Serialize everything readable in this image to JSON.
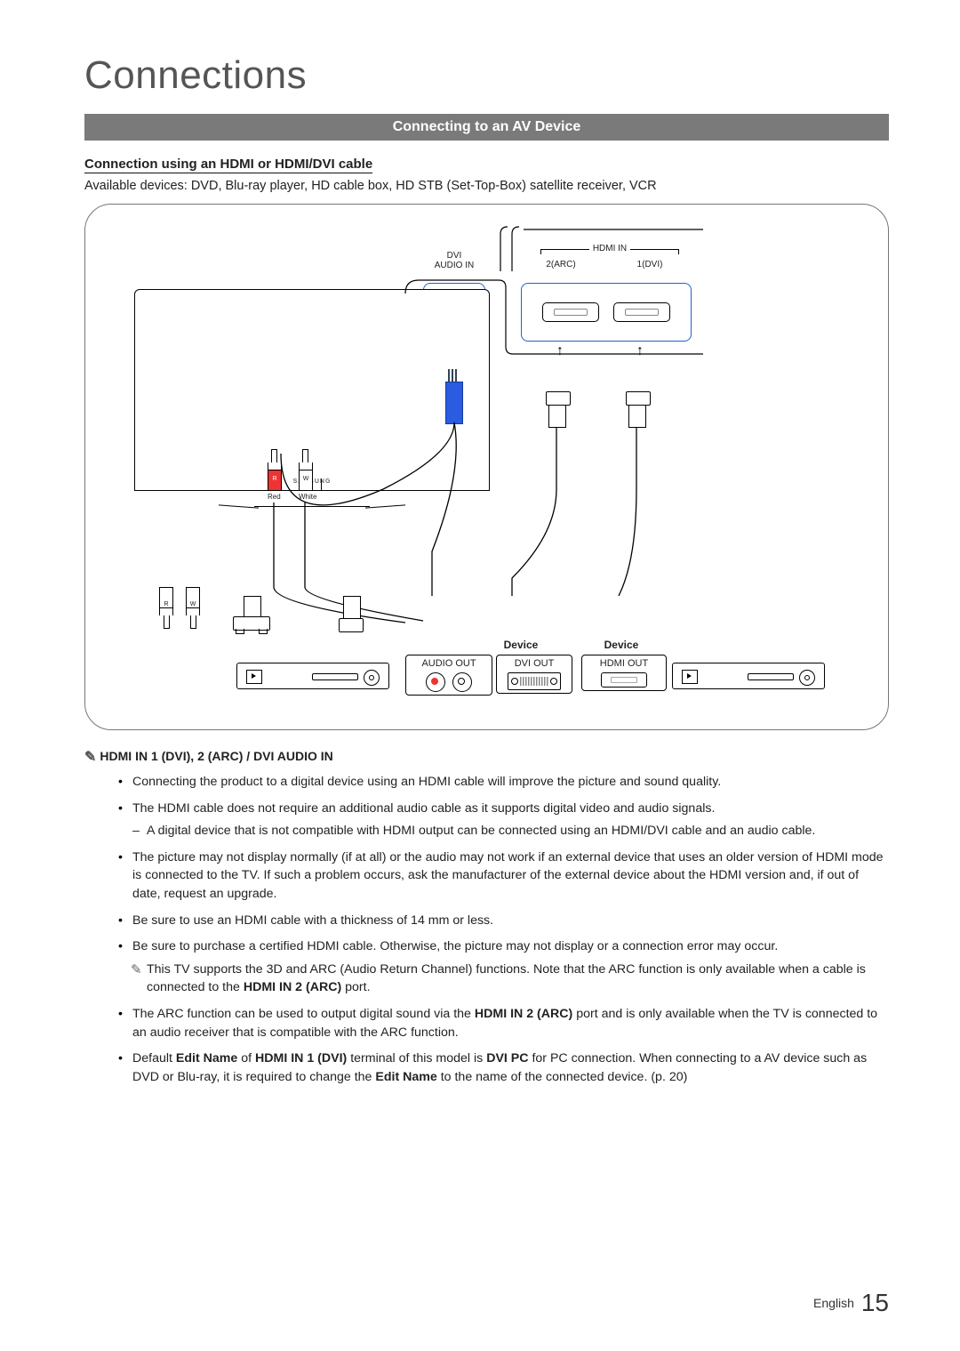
{
  "page": {
    "section_title": "Connections",
    "banner": "Connecting to an AV Device",
    "subhead": "Connection using an HDMI or HDMI/DVI cable",
    "available": "Available devices: DVD, Blu-ray player, HD cable box, HD STB (Set-Top-Box) satellite receiver, VCR"
  },
  "diagram": {
    "tv_brand": "SAMSUNG",
    "dvi_audio_label_1": "DVI",
    "dvi_audio_label_2": "AUDIO IN",
    "hdmi_in_label": "HDMI IN",
    "hdmi_in_2": "2(ARC)",
    "hdmi_in_1": "1(DVI)",
    "rca_red": "Red",
    "rca_white": "White",
    "rca_r": "R",
    "rca_w": "W",
    "rca_r2": "R",
    "rca_w2": "W",
    "device_label_left": "Device",
    "device_label_right": "Device",
    "audio_out": "AUDIO OUT",
    "dvi_out": "DVI OUT",
    "hdmi_out": "HDMI OUT"
  },
  "notes": {
    "title": "HDMI IN 1 (DVI), 2 (ARC) / DVI AUDIO IN",
    "b1": "Connecting the product to a digital device using an HDMI cable will improve the picture and sound quality.",
    "b2": "The HDMI cable does not require an additional audio cable as it supports digital video and audio signals.",
    "b2a": "A digital device that is not compatible with HDMI output can be connected using an HDMI/DVI cable and an audio cable.",
    "b3": "The picture may not display normally (if at all) or the audio may not work if an external device that uses an older version of HDMI mode is connected to the TV. If such a problem occurs, ask the manufacturer of the external device about the HDMI version and, if out of date, request an upgrade.",
    "b4": "Be sure to use an HDMI cable with a thickness of 14 mm or less.",
    "b5": "Be sure to purchase a certified HDMI cable. Otherwise, the picture may not display or a connection error may occur.",
    "b5a_pre": "This TV supports the 3D and ARC (Audio Return Channel) functions. Note that the ARC function is only available when a cable is connected to the ",
    "b5a_bold": "HDMI IN 2 (ARC)",
    "b5a_post": " port.",
    "b6_pre": "The ARC function can be used to output digital sound via the ",
    "b6_bold": "HDMI IN 2 (ARC)",
    "b6_post": " port and is only available when the TV is connected to an audio receiver that is compatible with the ARC function.",
    "b7_pre": "Default ",
    "b7_b1": "Edit Name",
    "b7_mid1": " of ",
    "b7_b2": "HDMI IN 1 (DVI)",
    "b7_mid2": " terminal of this model is ",
    "b7_b3": "DVI PC",
    "b7_mid3": " for PC connection. When connecting to a AV device such as DVD or Blu-ray, it is required to change the ",
    "b7_b4": "Edit Name",
    "b7_post": " to the name of the connected device. (p. 20)"
  },
  "footer": {
    "lang": "English",
    "page": "15"
  }
}
